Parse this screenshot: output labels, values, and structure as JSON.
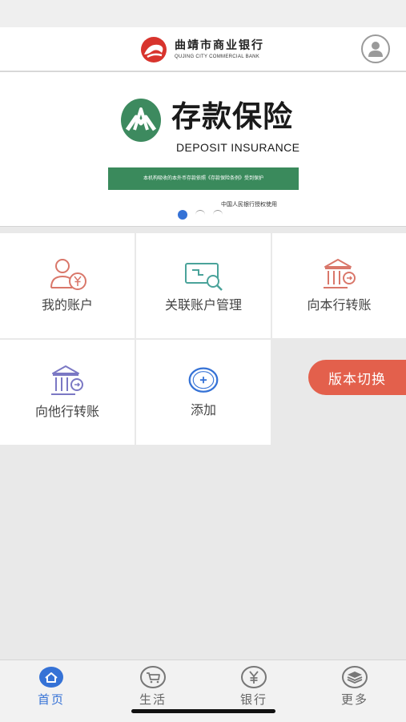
{
  "header": {
    "bank_name_cn": "曲靖市商业银行",
    "bank_name_en": "QUJING CITY COMMERCIAL BANK"
  },
  "banner": {
    "title": "存款保险",
    "subtitle": "DEPOSIT INSURANCE",
    "bar_text": "本机构吸收的本外币存款依照《存款保险条例》受到保护",
    "note": "中国人民银行授权使用",
    "page_count": 3,
    "active_page": 1
  },
  "grid": {
    "items": [
      {
        "label": "我的账户",
        "icon": "account-yuan-icon"
      },
      {
        "label": "关联账户管理",
        "icon": "linked-card-search-icon"
      },
      {
        "label": "向本行转账",
        "icon": "bank-transfer-icon"
      },
      {
        "label": "向他行转账",
        "icon": "other-bank-transfer-icon"
      },
      {
        "label": "添加",
        "icon": "add-circle-icon"
      }
    ]
  },
  "version_switch": "版本切换",
  "tabbar": {
    "items": [
      {
        "label": "首页",
        "icon": "home-icon",
        "active": true
      },
      {
        "label": "生活",
        "icon": "cart-icon",
        "active": false
      },
      {
        "label": "银行",
        "icon": "yuan-coin-icon",
        "active": false
      },
      {
        "label": "更多",
        "icon": "stack-icon",
        "active": false
      }
    ]
  },
  "colors": {
    "accent_blue": "#3572d6",
    "version_button": "#e3604c",
    "insurance_green": "#3a8a5c",
    "icon_red": "#d9776a",
    "icon_teal": "#4aa39a",
    "icon_purple": "#7b78c4"
  }
}
